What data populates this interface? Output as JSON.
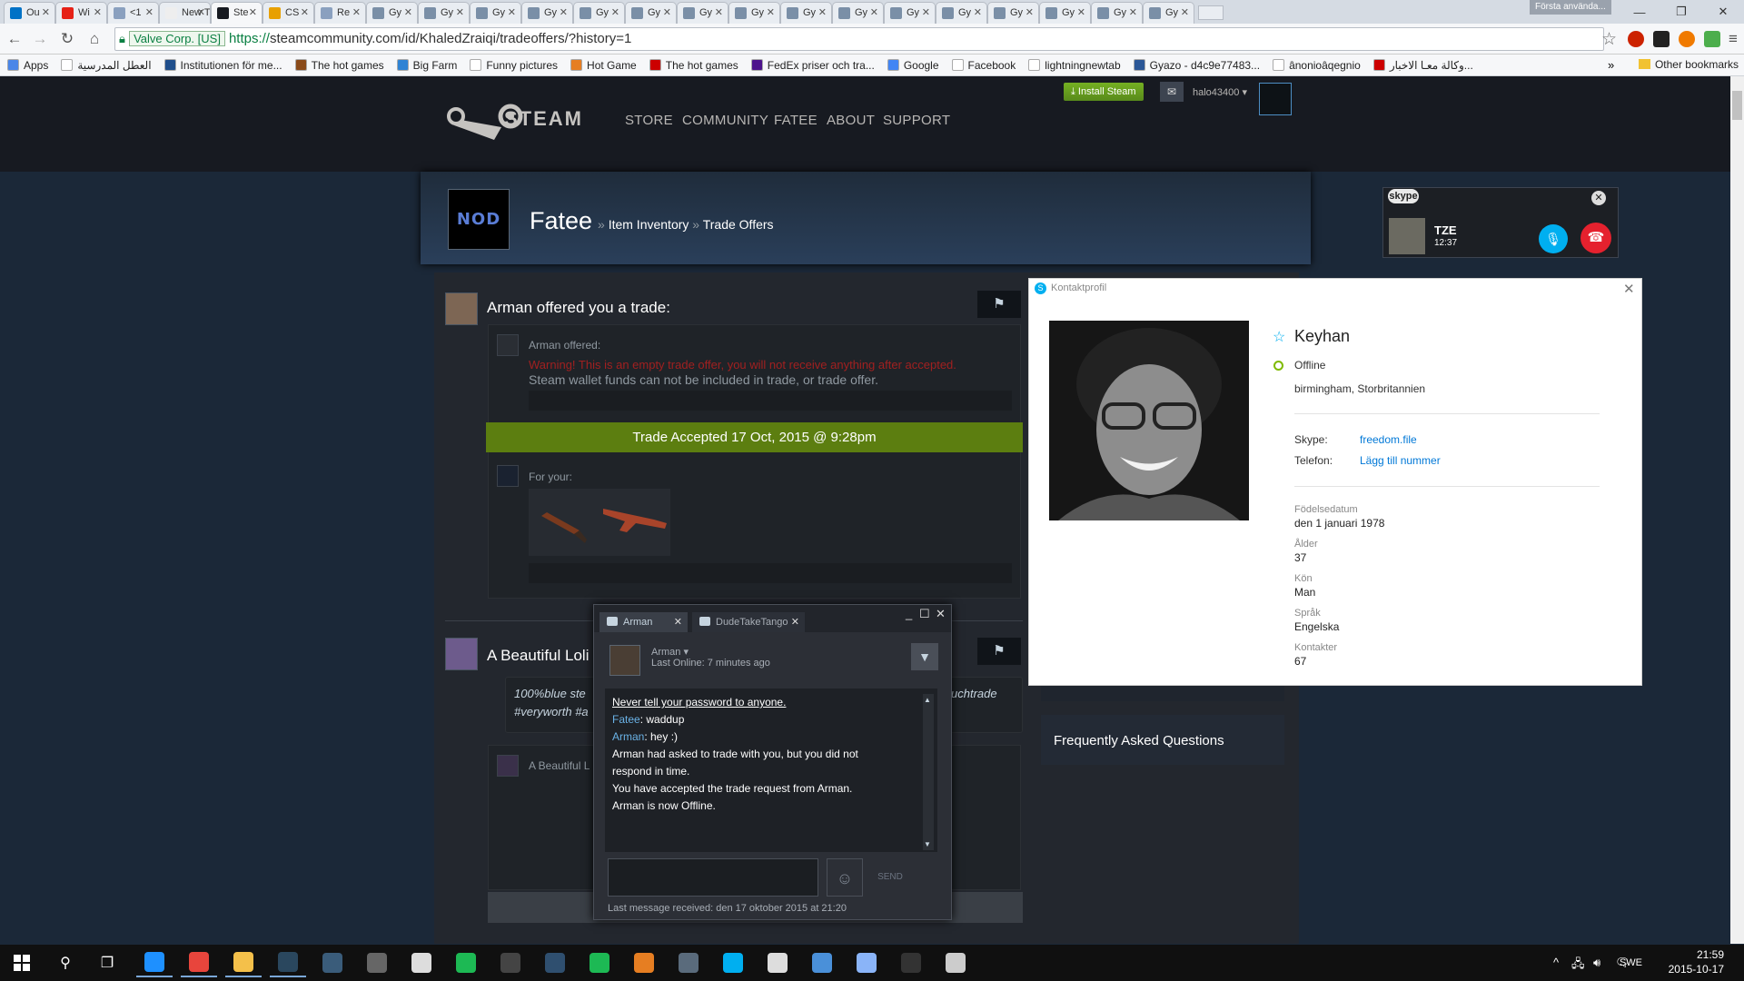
{
  "browser": {
    "tabs": [
      {
        "label": "Ou",
        "color": "#0072c6"
      },
      {
        "label": "Wi",
        "color": "#e62117"
      },
      {
        "label": "<1",
        "color": "#8aa0bf"
      },
      {
        "label": "New T",
        "color": "#eeeeee"
      },
      {
        "label": "Ste",
        "color": "#171a21"
      },
      {
        "label": "CS",
        "color": "#e8a000"
      },
      {
        "label": "Re",
        "color": "#8aa0bf"
      },
      {
        "label": "Gy",
        "color": "#7a8fa7"
      },
      {
        "label": "Gy",
        "color": "#7a8fa7"
      },
      {
        "label": "Gy",
        "color": "#7a8fa7"
      },
      {
        "label": "Gy",
        "color": "#7a8fa7"
      },
      {
        "label": "Gy",
        "color": "#7a8fa7"
      },
      {
        "label": "Gy",
        "color": "#7a8fa7"
      },
      {
        "label": "Gy",
        "color": "#7a8fa7"
      },
      {
        "label": "Gy",
        "color": "#7a8fa7"
      },
      {
        "label": "Gy",
        "color": "#7a8fa7"
      },
      {
        "label": "Gy",
        "color": "#7a8fa7"
      },
      {
        "label": "Gy",
        "color": "#7a8fa7"
      },
      {
        "label": "Gy",
        "color": "#7a8fa7"
      },
      {
        "label": "Gy",
        "color": "#7a8fa7"
      },
      {
        "label": "Gy",
        "color": "#7a8fa7"
      },
      {
        "label": "Gy",
        "color": "#7a8fa7"
      },
      {
        "label": "Gy",
        "color": "#7a8fa7"
      }
    ],
    "active_tab_index": 4,
    "profile_button": "Första använda...",
    "window_controls": {
      "minimize": "—",
      "maximize": "❐",
      "close": "✕"
    },
    "ev_badge": "Valve Corp. [US]",
    "url_https": "https://",
    "url_rest": "steamcommunity.com/id/KhaledZraiqi/tradeoffers/?history=1",
    "bookmarks": [
      {
        "label": "Apps",
        "color": "#4a86e8"
      },
      {
        "label": "العطل المدرسية",
        "color": "#ffffff"
      },
      {
        "label": "Institutionen för me...",
        "color": "#1f4e8c"
      },
      {
        "label": "The hot games",
        "color": "#8a4b1a"
      },
      {
        "label": "Big Farm",
        "color": "#2f83d4"
      },
      {
        "label": "Funny pictures",
        "color": "#ffffff"
      },
      {
        "label": "Hot Game",
        "color": "#e67e22"
      },
      {
        "label": "The hot games",
        "color": "#cc0000"
      },
      {
        "label": "FedEx priser och tra...",
        "color": "#4d148c"
      },
      {
        "label": "Google",
        "color": "#4285f4"
      },
      {
        "label": "Facebook",
        "color": "#ffffff"
      },
      {
        "label": "lightningnewtab",
        "color": "#ffffff"
      },
      {
        "label": "Gyazo - d4c9e77483...",
        "color": "#2b5797"
      },
      {
        "label": "ânonioâqegnio",
        "color": "#ffffff"
      },
      {
        "label": "وكالة معـا الاخبار...",
        "color": "#cc0000"
      }
    ],
    "overflow": "»",
    "other_bookmarks": "Other bookmarks"
  },
  "steam": {
    "logo_text": "STEAM",
    "nav": [
      "STORE",
      "COMMUNITY",
      "FATEE",
      "ABOUT",
      "SUPPORT"
    ],
    "install_label": "Install Steam",
    "username": "halo43400",
    "profile": {
      "avatar_text": "NOD",
      "name": "Fatee",
      "crumb1": "Item Inventory",
      "crumb2": "Trade Offers",
      "sep": "»"
    },
    "offer1": {
      "title": "Arman offered you a trade:",
      "sub": "Arman offered:",
      "warning": "Warning! This is an empty trade offer, you will not receive anything after accepted.",
      "wallet": "Steam wallet funds can not be included in trade, or trade offer.",
      "accepted": "Trade Accepted 17 Oct, 2015 @ 9:28pm",
      "for_your": "For your:"
    },
    "offer2": {
      "title": "A Beautiful Loli",
      "message_left": "100%blue ste",
      "message_left2": "#veryworth #a",
      "message_right": "uchtrade",
      "sub": "A Beautiful L"
    },
    "faq": "Frequently Asked Questions"
  },
  "chat": {
    "tabs": [
      "Arman",
      "DudeTakeTango"
    ],
    "window_buttons": [
      "_",
      "☐",
      "✕"
    ],
    "name": "Arman",
    "last_online": "Last Online: 7 minutes ago",
    "messages": [
      {
        "text": "Never tell your password to anyone.",
        "kind": "warn"
      },
      {
        "user": "Fatee",
        "text": ": waddup"
      },
      {
        "user": "Arman",
        "text": ": hey :)"
      },
      {
        "text": "Arman had asked to trade with you, but you did not respond in time."
      },
      {
        "text": "You have accepted the trade request from Arman."
      },
      {
        "text": "Arman is now Offline."
      }
    ],
    "send": "SEND",
    "last_received": "Last message received: den 17 oktober 2015 at 21:20"
  },
  "skype_bar": {
    "logo": "skype",
    "caller": "TZE",
    "time": "12:37"
  },
  "contact": {
    "title": "Kontaktprofil",
    "name": "Keyhan",
    "status": "Offline",
    "location": "birmingham, Storbritannien",
    "skype_label": "Skype:",
    "skype_value": "freedom.file",
    "phone_label": "Telefon:",
    "phone_value": "Lägg till nummer",
    "birth_label": "Födelsedatum",
    "birth_value": "den 1 januari 1978",
    "age_label": "Ålder",
    "age_value": "37",
    "sex_label": "Kön",
    "sex_value": "Man",
    "lang_label": "Språk",
    "lang_value": "Engelska",
    "contacts_label": "Kontakter",
    "contacts_value": "67"
  },
  "taskbar": {
    "apps": [
      {
        "name": "edge",
        "color": "#1e90ff"
      },
      {
        "name": "chrome",
        "color": "#e8453c"
      },
      {
        "name": "explorer",
        "color": "#f4c04a"
      },
      {
        "name": "steam",
        "color": "#2a475e"
      },
      {
        "name": "app",
        "color": "#3a5c7a"
      },
      {
        "name": "app",
        "color": "#666666"
      },
      {
        "name": "app",
        "color": "#dddddd"
      },
      {
        "name": "spotify",
        "color": "#1db954"
      },
      {
        "name": "calculator",
        "color": "#444444"
      },
      {
        "name": "app",
        "color": "#2f4f6f"
      },
      {
        "name": "app",
        "color": "#1db954"
      },
      {
        "name": "app",
        "color": "#e67e22"
      },
      {
        "name": "app",
        "color": "#5a6b7c"
      },
      {
        "name": "skype",
        "color": "#00aff0"
      },
      {
        "name": "app",
        "color": "#dddddd"
      },
      {
        "name": "app",
        "color": "#4a90d9"
      },
      {
        "name": "app",
        "color": "#8ab4f8"
      },
      {
        "name": "app",
        "color": "#333333"
      },
      {
        "name": "app",
        "color": "#cccccc"
      }
    ],
    "lang": "SWE",
    "time": "21:59",
    "date": "2015-10-17"
  }
}
